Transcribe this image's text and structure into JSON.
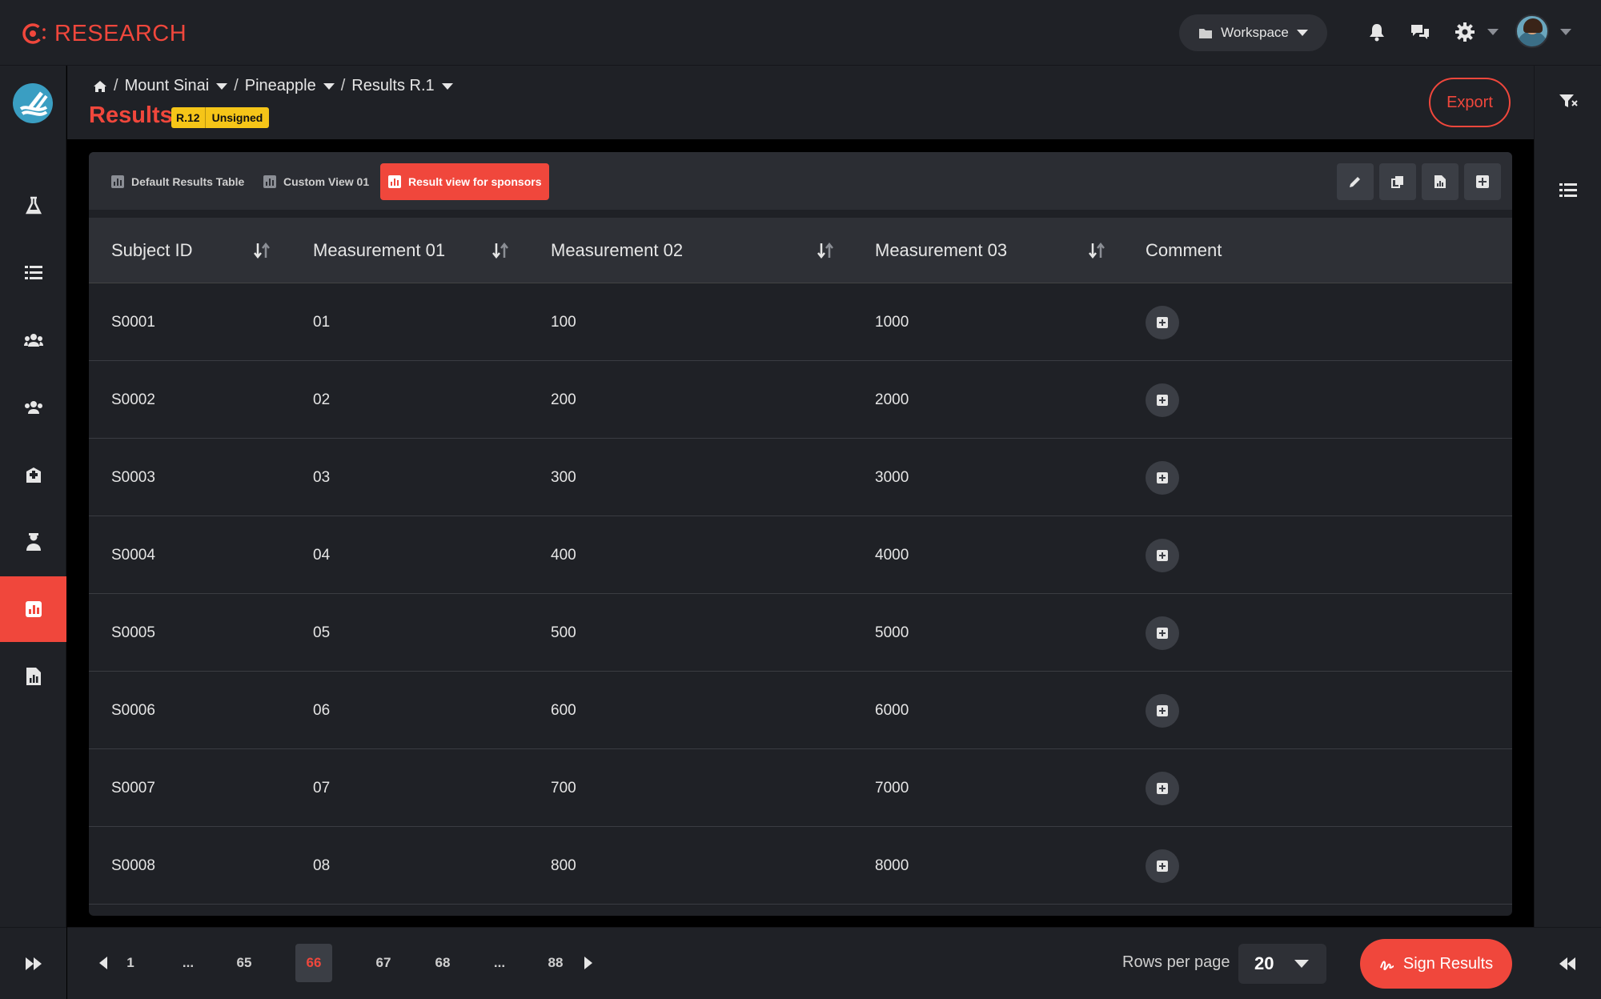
{
  "app": {
    "brand": "RESEARCH"
  },
  "topbar": {
    "workspace_label": "Workspace"
  },
  "breadcrumb": {
    "items": [
      "Mount Sinai",
      "Pineapple",
      "Results R.1"
    ]
  },
  "page": {
    "title": "Results",
    "revision_badge": "R.12",
    "status_badge": "Unsigned",
    "export_label": "Export"
  },
  "views": {
    "tabs": [
      "Default Results Table",
      "Custom View 01",
      "Result view for sponsors"
    ],
    "active_index": 2
  },
  "table": {
    "headers": [
      "Subject ID",
      "Measurement 01",
      "Measurement 02",
      "Measurement 03",
      "Comment"
    ],
    "rows": [
      [
        "S0001",
        "01",
        "100",
        "1000"
      ],
      [
        "S0002",
        "02",
        "200",
        "2000"
      ],
      [
        "S0003",
        "03",
        "300",
        "3000"
      ],
      [
        "S0004",
        "04",
        "400",
        "4000"
      ],
      [
        "S0005",
        "05",
        "500",
        "5000"
      ],
      [
        "S0006",
        "06",
        "600",
        "6000"
      ],
      [
        "S0007",
        "07",
        "700",
        "7000"
      ],
      [
        "S0008",
        "08",
        "800",
        "8000"
      ]
    ]
  },
  "pagination": {
    "pages": [
      "1",
      "...",
      "65",
      "66",
      "67",
      "68",
      "...",
      "88"
    ],
    "current": "66"
  },
  "footer": {
    "rows_per_page_label": "Rows per page",
    "rows_per_page_value": "20",
    "sign_label": "Sign Results"
  },
  "colors": {
    "accent": "#f0473c",
    "badge": "#f5c518",
    "surface": "#1f2126",
    "header": "#2e3036"
  }
}
